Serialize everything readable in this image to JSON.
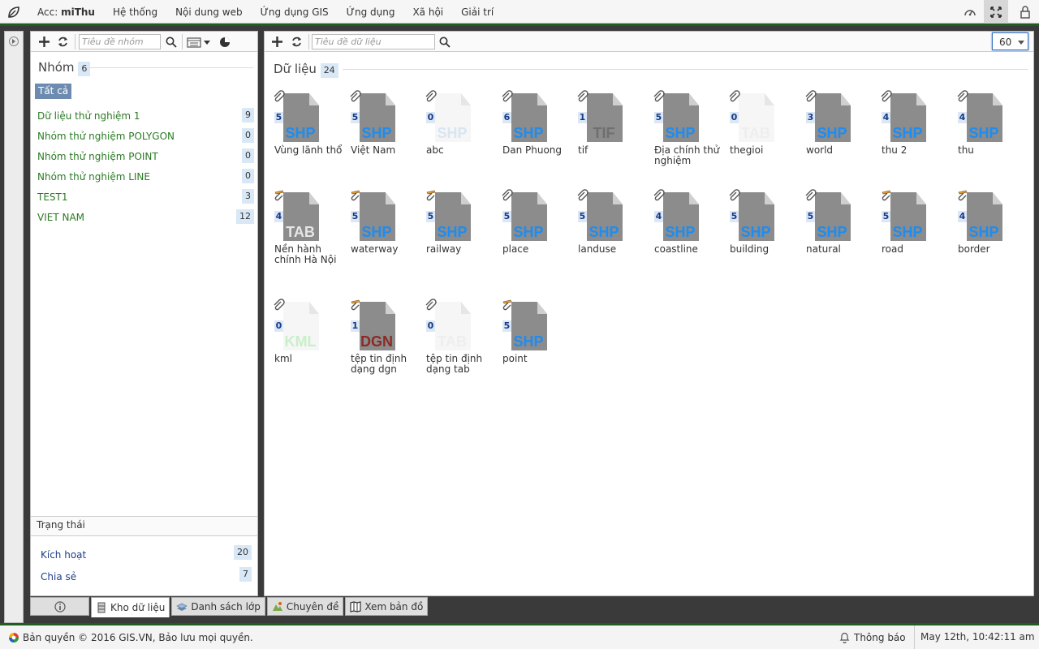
{
  "header": {
    "acc_label": "Acc:",
    "acc_user": "miThu",
    "menu": [
      "Hệ thống",
      "Nội dung web",
      "Ứng dụng GIS",
      "Ứng dụng",
      "Xã hội",
      "Giải trí"
    ]
  },
  "left_panel": {
    "search_placeholder": "Tiêu đề nhóm",
    "groups_title": "Nhóm",
    "groups_count": "6",
    "all_label": "Tất cả",
    "groups": [
      {
        "name": "Dữ liệu thử nghiệm 1",
        "count": "9"
      },
      {
        "name": "Nhóm thử nghiệm POLYGON",
        "count": "0"
      },
      {
        "name": "Nhóm thử nghiệm POINT",
        "count": "0"
      },
      {
        "name": "Nhóm thử nghiệm LINE",
        "count": "0"
      },
      {
        "name": "TEST1",
        "count": "3"
      },
      {
        "name": "VIET NAM",
        "count": "12"
      }
    ],
    "status_title": "Trạng thái",
    "status_items": [
      {
        "name": "Kích hoạt",
        "count": "20"
      },
      {
        "name": "Chia sẻ",
        "count": "7"
      }
    ]
  },
  "right_panel": {
    "search_placeholder": "Tiêu đề dữ liệu",
    "page_size": "60",
    "data_title": "Dữ liệu",
    "data_count": "24",
    "items": [
      {
        "name": "Vùng lãnh thổ",
        "type": "SHP",
        "count": "5",
        "icon": "paperclip-icon"
      },
      {
        "name": "Việt Nam",
        "type": "SHP",
        "count": "5",
        "icon": "paperclip-icon"
      },
      {
        "name": "abc",
        "type": "SHP",
        "count": "0",
        "icon": "paperclip-icon"
      },
      {
        "name": "Dan Phuong",
        "type": "SHP",
        "count": "6",
        "icon": "paperclip-icon"
      },
      {
        "name": "tif",
        "type": "TIF",
        "count": "1",
        "icon": "paperclip-icon"
      },
      {
        "name": "Địa chính thử nghiệm",
        "type": "SHP",
        "count": "5",
        "icon": "paperclip-icon"
      },
      {
        "name": "thegioi",
        "type": "TAB",
        "count": "0",
        "icon": "paperclip-icon"
      },
      {
        "name": "world",
        "type": "SHP",
        "count": "3",
        "icon": "paperclip-icon"
      },
      {
        "name": "thu 2",
        "type": "SHP",
        "count": "4",
        "icon": "paperclip-icon"
      },
      {
        "name": "thu",
        "type": "SHP",
        "count": "4",
        "icon": "paperclip-icon"
      },
      {
        "name": "Nền hành chính Hà Nội",
        "type": "TAB",
        "count": "4",
        "icon": "edit-clip-icon"
      },
      {
        "name": "waterway",
        "type": "SHP",
        "count": "5",
        "icon": "edit-clip-icon"
      },
      {
        "name": "railway",
        "type": "SHP",
        "count": "5",
        "icon": "edit-clip-icon"
      },
      {
        "name": "place",
        "type": "SHP",
        "count": "5",
        "icon": "paperclip-icon"
      },
      {
        "name": "landuse",
        "type": "SHP",
        "count": "5",
        "icon": "paperclip-icon"
      },
      {
        "name": "coastline",
        "type": "SHP",
        "count": "4",
        "icon": "paperclip-icon"
      },
      {
        "name": "building",
        "type": "SHP",
        "count": "5",
        "icon": "paperclip-icon"
      },
      {
        "name": "natural",
        "type": "SHP",
        "count": "5",
        "icon": "paperclip-icon"
      },
      {
        "name": "road",
        "type": "SHP",
        "count": "5",
        "icon": "edit-clip-icon"
      },
      {
        "name": "border",
        "type": "SHP",
        "count": "4",
        "icon": "edit-clip-icon"
      },
      {
        "name": "kml",
        "type": "KML",
        "count": "0",
        "icon": "paperclip-icon"
      },
      {
        "name": "tệp tin định dạng dgn",
        "type": "DGN",
        "count": "1",
        "icon": "edit-clip-icon"
      },
      {
        "name": "tệp tin định dạng tab",
        "type": "TAB",
        "count": "0",
        "icon": "paperclip-icon"
      },
      {
        "name": "point",
        "type": "SHP",
        "count": "5",
        "icon": "edit-clip-icon"
      }
    ]
  },
  "tabs": [
    "Kho dữ liệu",
    "Danh sách lớp",
    "Chuyên đề",
    "Xem bản đồ"
  ],
  "footer": {
    "copyright": "Bản quyền © 2016 GIS.VN, Bảo lưu mọi quyền.",
    "notifications": "Thông báo",
    "datetime": "May 12th, 10:42:11 am"
  },
  "colors": {
    "shp_text": "#1e8cf0",
    "tif_text": "#6f6f6f",
    "tab_text": "#e6e6e6",
    "dgn_text": "#8b2a24",
    "kml_text": "#c8f0c8",
    "group_link": "#2a7a24",
    "status_link": "#1e3f8c",
    "header_green": "#1f5c1f"
  }
}
